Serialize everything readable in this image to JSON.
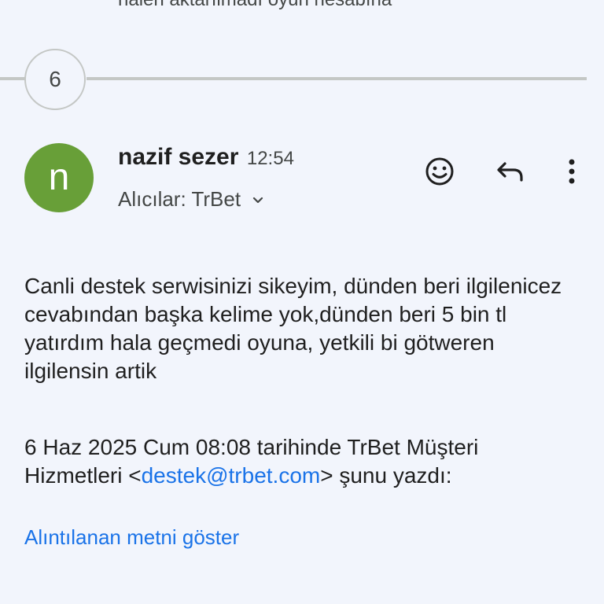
{
  "previous_snippet": "halen aktarılmadı oyun hesabına",
  "thread": {
    "collapsed_count": "6"
  },
  "message": {
    "avatar_letter": "n",
    "sender_name": "nazif sezer",
    "time": "12:54",
    "recipients_label": "Alıcılar: TrBet",
    "body": "Canli destek serwisinizi sikeyim, dünden beri ilgilenicez cevabından başka kelime yok,dünden beri 5 bin tl yatırdım hala geçmedi oyuna, yetkili bi götweren ilgilensin artik",
    "quote_header_prefix": "6 Haz 2025 Cum 08:08 tarihinde TrBet Müşteri Hizmetleri <",
    "quote_email": "destek@trbet.com",
    "quote_header_suffix": "> şunu yazdı:",
    "show_quoted_label": "Alıntılanan metni göster"
  },
  "icons": {
    "react": "emoji-smile-icon",
    "reply": "reply-arrow-icon",
    "more": "more-vert-icon",
    "recipients_toggle": "chevron-down-icon"
  },
  "colors": {
    "background": "#f2f5fc",
    "avatar": "#689f38",
    "link": "#1a73e8",
    "secondary_text": "#444746",
    "divider": "#c4c7c5"
  }
}
